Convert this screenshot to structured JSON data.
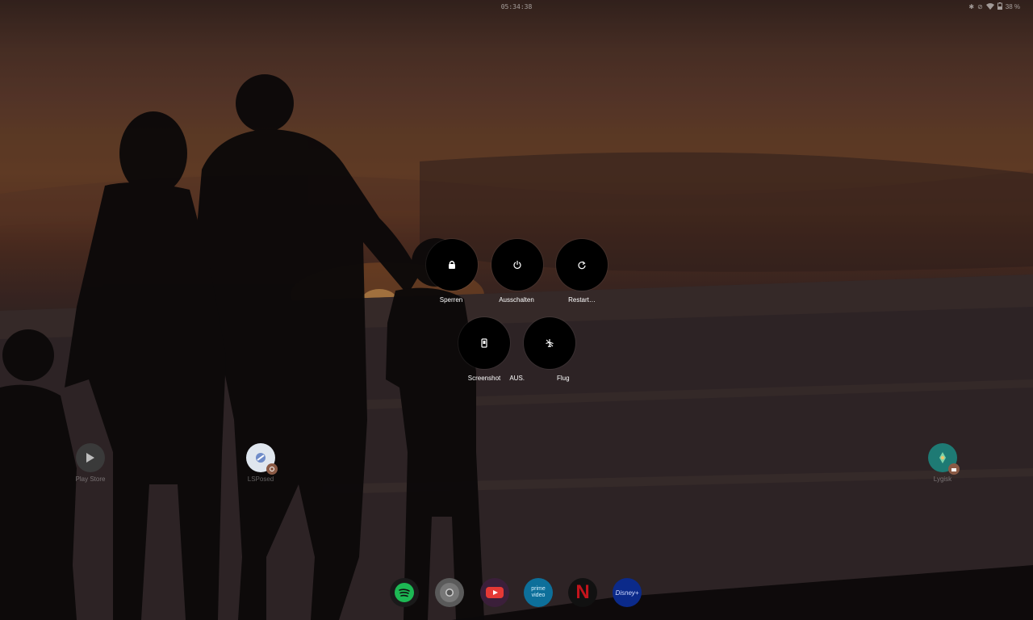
{
  "status_bar": {
    "clock": "05:34:38",
    "battery_text": "38 %",
    "icons": [
      "bluetooth-icon",
      "vibrate-off-icon",
      "wifi-icon",
      "battery-icon"
    ]
  },
  "power_menu": {
    "items": [
      {
        "label": "Sperren",
        "icon": "lock-icon"
      },
      {
        "label": "Ausschalten",
        "icon": "power-icon"
      },
      {
        "label": "Restart…",
        "icon": "restart-icon"
      },
      {
        "label": "Screenshot",
        "icon": "screenshot-icon"
      },
      {
        "label": "Flugmodus AUS",
        "icon": "airplane-off-icon"
      }
    ],
    "overlap_fragments": [
      "AUS.",
      "Flug"
    ]
  },
  "home_apps": [
    {
      "label": "Play Store",
      "icon": "play-store-icon"
    },
    {
      "label": "LSPosed",
      "icon": "lsposed-icon",
      "badge": "work-badge-icon"
    },
    {
      "label": "Lygisk",
      "icon": "lygisk-icon",
      "badge": "work-badge-icon"
    }
  ],
  "dock": [
    {
      "name": "Spotify",
      "icon": "spotify-icon",
      "color": "#1db954"
    },
    {
      "name": "Chrome",
      "icon": "chrome-icon",
      "color": "#9e9e9e"
    },
    {
      "name": "YouTube",
      "icon": "youtube-icon",
      "color": "#e53935"
    },
    {
      "name": "prime video",
      "icon": "prime-video-icon",
      "color": "#00a8e1",
      "text": "prime video"
    },
    {
      "name": "Netflix",
      "icon": "netflix-icon",
      "color": "#e50914",
      "text": "N"
    },
    {
      "name": "Disney+",
      "icon": "disney-plus-icon",
      "color": "#113ccf",
      "text": "Disney+"
    }
  ]
}
